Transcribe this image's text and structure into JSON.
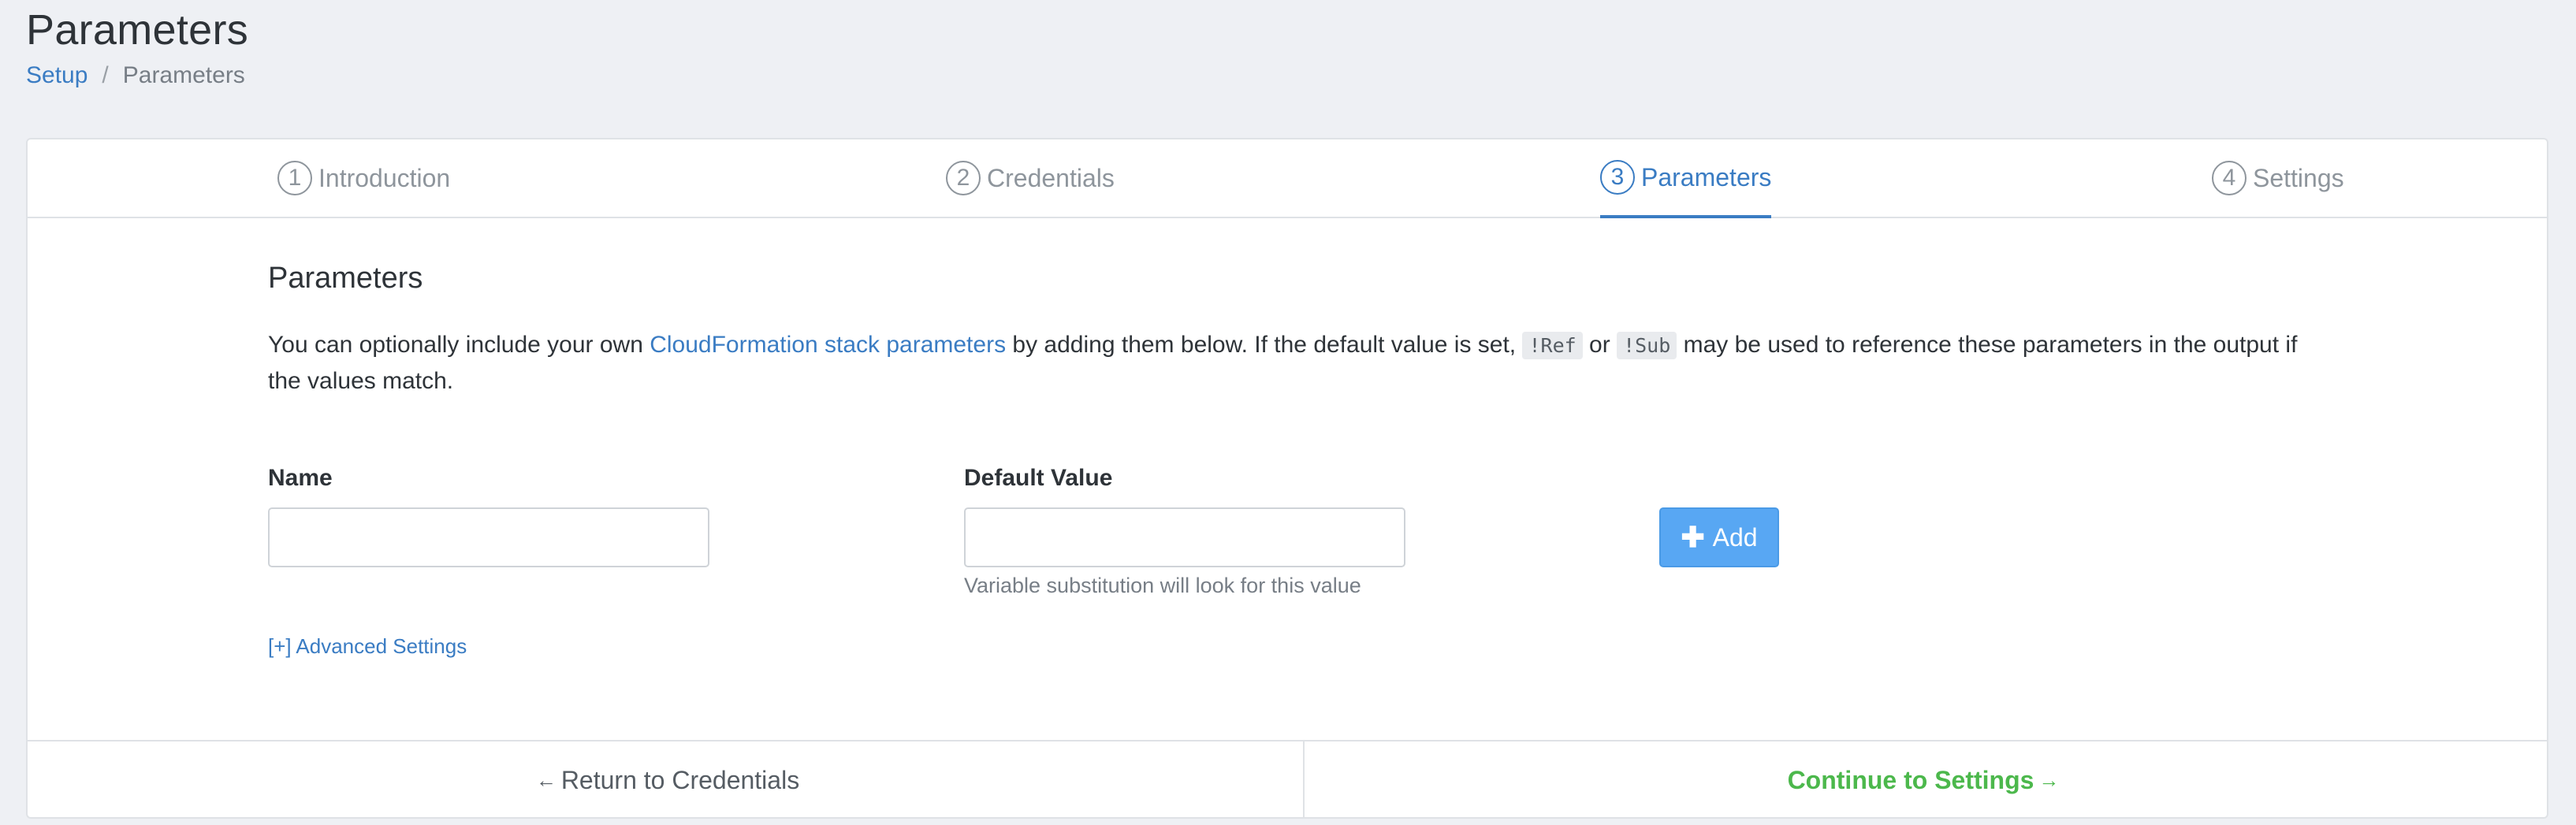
{
  "header": {
    "title": "Parameters",
    "breadcrumb": {
      "root": "Setup",
      "separator": "/",
      "current": "Parameters"
    }
  },
  "steps": [
    {
      "number": "1",
      "label": "Introduction",
      "active": false
    },
    {
      "number": "2",
      "label": "Credentials",
      "active": false
    },
    {
      "number": "3",
      "label": "Parameters",
      "active": true
    },
    {
      "number": "4",
      "label": "Settings",
      "active": false
    }
  ],
  "section": {
    "title": "Parameters",
    "desc_part1": "You can optionally include your own ",
    "desc_link": "CloudFormation stack parameters",
    "desc_part2": " by adding them below. If the default value is set, ",
    "code_ref": "!Ref",
    "desc_or": " or ",
    "code_sub": "!Sub",
    "desc_part3": " may be used to reference these parameters in the output if the values match."
  },
  "form": {
    "name_label": "Name",
    "name_value": "",
    "default_label": "Default Value",
    "default_value": "",
    "default_help": "Variable substitution will look for this value",
    "add_label": "Add",
    "advanced_link": "[+] Advanced Settings"
  },
  "footer": {
    "back_arrow": "←",
    "back_label": "Return to Credentials",
    "next_label": "Continue to Settings",
    "next_arrow": "→"
  },
  "colors": {
    "accent": "#3a7cc3",
    "add_button": "#58a7f3",
    "continue": "#4cb84c",
    "background": "#eef0f4"
  }
}
